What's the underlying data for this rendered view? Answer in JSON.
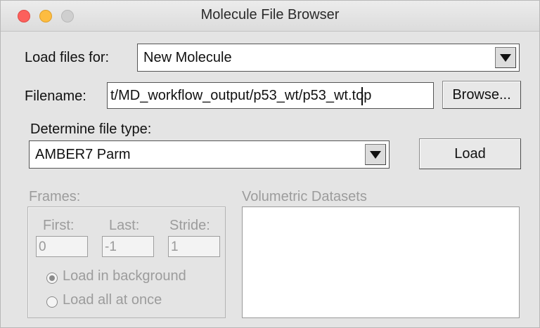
{
  "window": {
    "title": "Molecule File Browser"
  },
  "load_for": {
    "label": "Load files for:",
    "selected": "New Molecule"
  },
  "filename": {
    "label": "Filename:",
    "value": "t/MD_workflow_output/p53_wt/p53_wt.top"
  },
  "browse_button": "Browse...",
  "file_type": {
    "label": "Determine file type:",
    "selected": "AMBER7 Parm"
  },
  "load_button": "Load",
  "frames": {
    "label": "Frames:",
    "first_label": "First:",
    "last_label": "Last:",
    "stride_label": "Stride:",
    "first_value": "0",
    "last_value": "-1",
    "stride_value": "1",
    "load_background": "Load in background",
    "load_all": "Load all at once",
    "selected_mode": "Load in background"
  },
  "volumetric": {
    "label": "Volumetric Datasets"
  },
  "colors": {
    "close": "#fc605c",
    "minimize": "#fdbc40",
    "zoom_inactive": "#cfcfcf",
    "window_bg": "#e4e4e4",
    "disabled_text": "#9c9c9c"
  }
}
